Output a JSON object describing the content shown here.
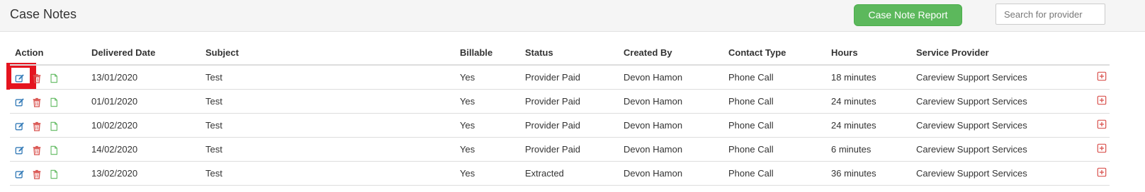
{
  "header": {
    "title": "Case Notes",
    "report_button": "Case Note Report",
    "search_placeholder": "Search for provider"
  },
  "table": {
    "columns": [
      "Action",
      "Delivered Date",
      "Subject",
      "Billable",
      "Status",
      "Created By",
      "Contact Type",
      "Hours",
      "Service Provider"
    ],
    "rows": [
      {
        "date": "13/01/2020",
        "subject": "Test",
        "billable": "Yes",
        "status": "Provider Paid",
        "created_by": "Devon Hamon",
        "contact_type": "Phone Call",
        "hours": "18 minutes",
        "provider": "Careview Support Services"
      },
      {
        "date": "01/01/2020",
        "subject": "Test",
        "billable": "Yes",
        "status": "Provider Paid",
        "created_by": "Devon Hamon",
        "contact_type": "Phone Call",
        "hours": "24 minutes",
        "provider": "Careview Support Services"
      },
      {
        "date": "10/02/2020",
        "subject": "Test",
        "billable": "Yes",
        "status": "Provider Paid",
        "created_by": "Devon Hamon",
        "contact_type": "Phone Call",
        "hours": "24 minutes",
        "provider": "Careview Support Services"
      },
      {
        "date": "14/02/2020",
        "subject": "Test",
        "billable": "Yes",
        "status": "Provider Paid",
        "created_by": "Devon Hamon",
        "contact_type": "Phone Call",
        "hours": "6 minutes",
        "provider": "Careview Support Services"
      },
      {
        "date": "13/02/2020",
        "subject": "Test",
        "billable": "Yes",
        "status": "Extracted",
        "created_by": "Devon Hamon",
        "contact_type": "Phone Call",
        "hours": "36 minutes",
        "provider": "Careview Support Services"
      }
    ]
  },
  "icons": {
    "edit": "edit-icon",
    "delete": "trash-icon",
    "document": "document-icon",
    "expand": "plus-square-icon"
  },
  "colors": {
    "edit": "#337ab7",
    "delete": "#d9534f",
    "document": "#5cb85c",
    "primary_button": "#5cb85c",
    "highlight": "#e5141f"
  }
}
